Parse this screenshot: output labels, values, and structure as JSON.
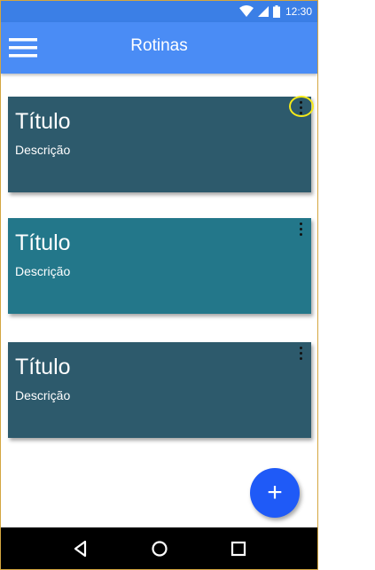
{
  "status_bar": {
    "time": "12:30"
  },
  "app_bar": {
    "title": "Rotinas",
    "color": "#4a8cf5"
  },
  "cards": [
    {
      "title": "Título",
      "description": "Descrição",
      "color": "#2d5a6c"
    },
    {
      "title": "Título",
      "description": "Descrição",
      "color": "#23778a"
    },
    {
      "title": "Título",
      "description": "Descrição",
      "color": "#2d5a6c"
    }
  ],
  "fab": {
    "icon": "plus-icon",
    "label": "+"
  },
  "nav": {
    "buttons": [
      "back-icon",
      "home-icon",
      "recents-icon"
    ]
  }
}
